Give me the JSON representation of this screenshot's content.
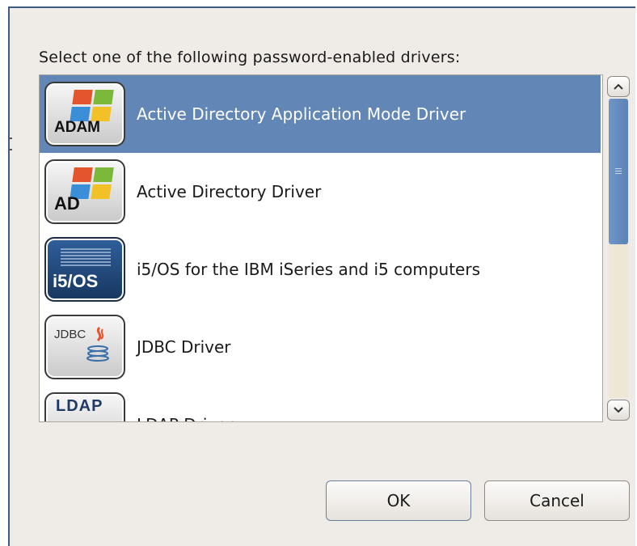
{
  "dialog": {
    "prompt": "Select one of the following password-enabled drivers:",
    "ok_label": "OK",
    "cancel_label": "Cancel"
  },
  "drivers": [
    {
      "icon_text": "ADAM",
      "icon": "windows-flag-icon",
      "label": "Active Directory Application Mode Driver",
      "selected": true
    },
    {
      "icon_text": "AD",
      "icon": "windows-flag-icon",
      "label": "Active Directory Driver",
      "selected": false
    },
    {
      "icon_text": "i5/OS",
      "icon": "ibm-icon",
      "label": "i5/OS for the IBM iSeries and i5 computers",
      "selected": false
    },
    {
      "icon_text": "JDBC",
      "icon": "java-cup-icon",
      "label": "JDBC Driver",
      "selected": false
    },
    {
      "icon_text": "LDAP",
      "icon": "ldap-icon",
      "label": "LDAP Driver",
      "selected": false
    }
  ],
  "colors": {
    "selection": "#6286b5",
    "dialog_bg": "#efebe7",
    "scroll_thumb": "#6286b5"
  }
}
